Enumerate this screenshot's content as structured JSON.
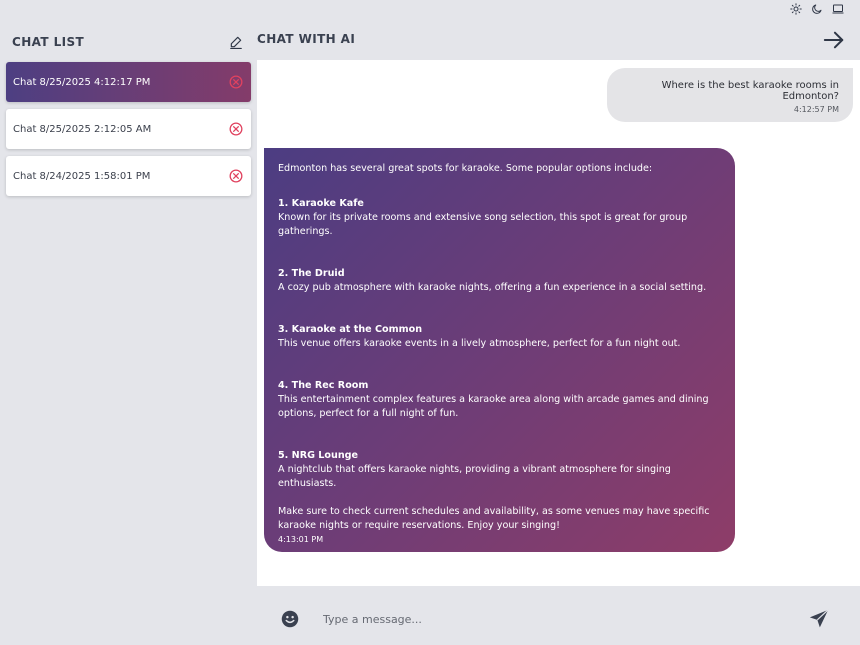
{
  "theme_icons": [
    "sun-icon",
    "moon-icon",
    "monitor-icon"
  ],
  "sidebar": {
    "title": "CHAT LIST",
    "new_chat_icon": "edit-icon",
    "chats": [
      {
        "label": "Chat 8/25/2025 4:12:17 PM",
        "active": true
      },
      {
        "label": "Chat 8/25/2025 2:12:05 AM",
        "active": false
      },
      {
        "label": "Chat 8/24/2025 1:58:01 PM",
        "active": false
      }
    ]
  },
  "chat": {
    "title": "CHAT WITH AI",
    "back_icon": "arrow-right-icon",
    "user_message": {
      "text": "Where is the best karaoke rooms in Edmonton?",
      "time": "4:12:57 PM"
    },
    "ai_message": {
      "intro": "Edmonton has several great spots for karaoke. Some popular options include:",
      "items": [
        {
          "title": "1. Karaoke Kafe",
          "desc": "Known for its private rooms and extensive song selection, this spot is great for group gatherings."
        },
        {
          "title": "2. The Druid",
          "desc": "A cozy pub atmosphere with karaoke nights, offering a fun experience in a social setting."
        },
        {
          "title": "3. Karaoke at the Common",
          "desc": "This venue offers karaoke events in a lively atmosphere, perfect for a fun night out."
        },
        {
          "title": "4. The Rec Room",
          "desc": "This entertainment complex features a karaoke area along with arcade games and dining options, perfect for a full night of fun."
        },
        {
          "title": "5. NRG Lounge",
          "desc": "A nightclub that offers karaoke nights, providing a vibrant atmosphere for singing enthusiasts."
        }
      ],
      "outro": "Make sure to check current schedules and availability, as some venues may have specific karaoke nights or require reservations. Enjoy your singing!",
      "time": "4:13:01 PM"
    }
  },
  "composer": {
    "placeholder": "Type a message...",
    "emoji_icon": "smiley-icon",
    "send_icon": "send-icon"
  },
  "colors": {
    "background": "#e4e5ea",
    "accent_start": "#4c3d82",
    "accent_end": "#8e3d68",
    "delete": "#e0425f"
  }
}
